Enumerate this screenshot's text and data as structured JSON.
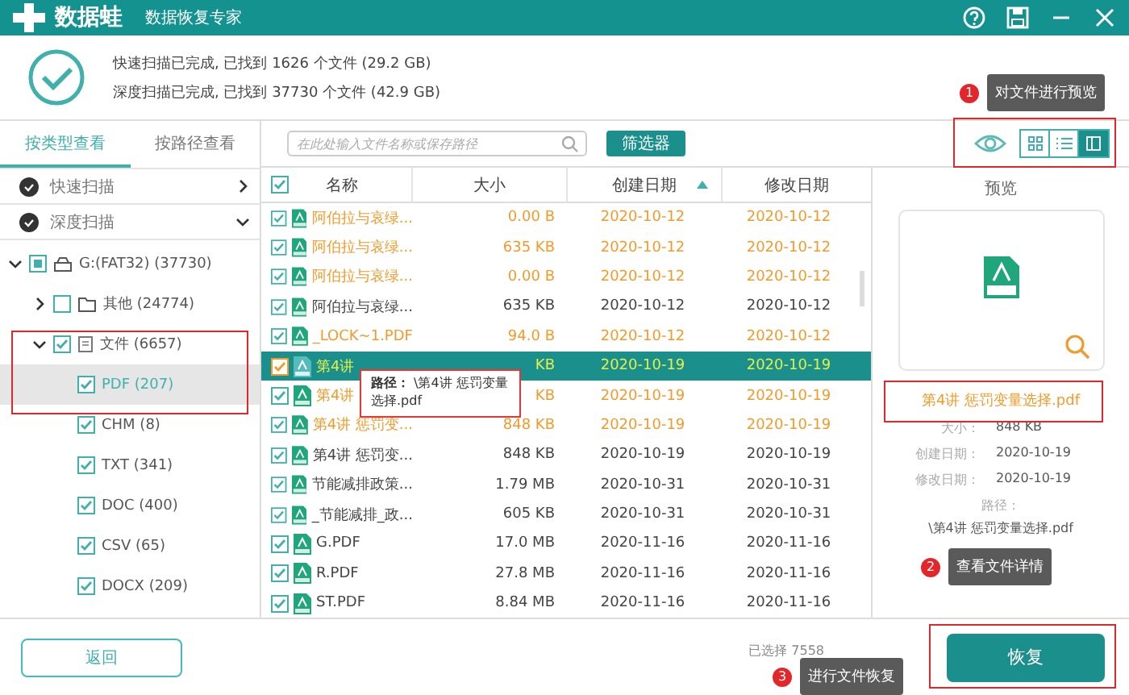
{
  "header": {
    "brand": "数据蛙",
    "subtitle": "数据恢复专家"
  },
  "scan_summary": [
    "快速扫描已完成, 已找到 1626 个文件 (29.2 GB)",
    "深度扫描已完成, 已找到 37730 个文件 (42.9 GB)"
  ],
  "view_tabs": [
    {
      "label": "按类型查看",
      "selected": true
    },
    {
      "label": "按路径查看",
      "selected": false
    }
  ],
  "scans": [
    {
      "label": "快速扫描",
      "expanded": false
    },
    {
      "label": "深度扫描",
      "expanded": true
    }
  ],
  "tree": [
    {
      "label": "G:(FAT32) (37730)",
      "kind": "drive",
      "checked": false,
      "partial": true,
      "expanded": true,
      "selected": false,
      "children": [
        {
          "label": "其他 (24774)",
          "kind": "folder",
          "checked": false,
          "partial": false,
          "expanded": false,
          "selected": false
        },
        {
          "label": "文件 (6657)",
          "kind": "document",
          "checked": true,
          "partial": false,
          "expanded": true,
          "selected": false,
          "children": [
            {
              "label": "PDF (207)",
              "checked": true,
              "selected": true
            },
            {
              "label": "CHM (8)",
              "checked": true,
              "selected": false
            },
            {
              "label": "TXT (341)",
              "checked": true,
              "selected": false
            },
            {
              "label": "DOC (400)",
              "checked": true,
              "selected": false
            },
            {
              "label": "CSV (65)",
              "checked": true,
              "selected": false
            },
            {
              "label": "DOCX (209)",
              "checked": true,
              "selected": false
            }
          ]
        }
      ]
    }
  ],
  "search": {
    "placeholder": "在此处输入文件名称或保存路径"
  },
  "filter_button": "筛选器",
  "table": {
    "all_checked": true,
    "columns": [
      {
        "label": "名称",
        "sorted": false
      },
      {
        "label": "大小",
        "sorted": false
      },
      {
        "label": "创建日期",
        "sorted": true
      },
      {
        "label": "修改日期",
        "sorted": false
      }
    ],
    "rows": [
      {
        "name": "阿伯拉与哀绿...",
        "size": "0.00  B",
        "created": "2020-10-12",
        "modified": "2020-10-12",
        "deleted": true,
        "selected": false,
        "checked": true
      },
      {
        "name": "阿伯拉与哀绿...",
        "size": "635 KB",
        "created": "2020-10-12",
        "modified": "2020-10-12",
        "deleted": true,
        "selected": false,
        "checked": true
      },
      {
        "name": "阿伯拉与哀绿...",
        "size": "0.00  B",
        "created": "2020-10-12",
        "modified": "2020-10-12",
        "deleted": true,
        "selected": false,
        "checked": true
      },
      {
        "name": "阿伯拉与哀绿...",
        "size": "635 KB",
        "created": "2020-10-12",
        "modified": "2020-10-12",
        "deleted": false,
        "selected": false,
        "checked": true
      },
      {
        "name": "_LOCK~1.PDF",
        "size": "94.0  B",
        "created": "2020-10-12",
        "modified": "2020-10-12",
        "deleted": true,
        "selected": false,
        "checked": true
      },
      {
        "name": "第4讲",
        "size": "KB",
        "created": "2020-10-19",
        "modified": "2020-10-19",
        "deleted": true,
        "selected": true,
        "checked": true
      },
      {
        "name": "第4讲",
        "size": "KB",
        "created": "2020-10-19",
        "modified": "2020-10-19",
        "deleted": true,
        "selected": false,
        "checked": true
      },
      {
        "name": "第4讲 惩罚变...",
        "size": "848 KB",
        "created": "2020-10-19",
        "modified": "2020-10-19",
        "deleted": true,
        "selected": false,
        "checked": true
      },
      {
        "name": "第4讲 惩罚变...",
        "size": "848 KB",
        "created": "2020-10-19",
        "modified": "2020-10-19",
        "deleted": false,
        "selected": false,
        "checked": true
      },
      {
        "name": "节能减排政策...",
        "size": "1.79 MB",
        "created": "2020-10-31",
        "modified": "2020-10-31",
        "deleted": false,
        "selected": false,
        "checked": true
      },
      {
        "name": "_节能减排_政...",
        "size": "605 KB",
        "created": "2020-10-31",
        "modified": "2020-10-31",
        "deleted": false,
        "selected": false,
        "checked": true
      },
      {
        "name": "G.PDF",
        "size": "17.0 MB",
        "created": "2020-11-16",
        "modified": "2020-11-16",
        "deleted": false,
        "selected": false,
        "checked": true
      },
      {
        "name": "R.PDF",
        "size": "27.8 MB",
        "created": "2020-11-16",
        "modified": "2020-11-16",
        "deleted": false,
        "selected": false,
        "checked": true
      },
      {
        "name": "ST.PDF",
        "size": "8.84 MB",
        "created": "2020-11-16",
        "modified": "2020-11-16",
        "deleted": false,
        "selected": false,
        "checked": true
      }
    ]
  },
  "path_tooltip": {
    "label": "路径：",
    "text": "\\第4讲 惩罚变量选择.pdf"
  },
  "view_modes": [
    {
      "kind": "grid",
      "selected": false
    },
    {
      "kind": "list",
      "selected": false
    },
    {
      "kind": "preview",
      "selected": true
    }
  ],
  "preview": {
    "title": "预览",
    "file_name": "第4讲 惩罚变量选择.pdf",
    "details": [
      {
        "label": "大小：",
        "value": "848 KB"
      },
      {
        "label": "创建日期：",
        "value": "2020-10-19"
      },
      {
        "label": "修改日期：",
        "value": "2020-10-19"
      }
    ],
    "path_label": "路径：",
    "path": "\\第4讲 惩罚变量选择.pdf"
  },
  "footer": {
    "back_button": "返回",
    "selection": "已选择 7558",
    "restore_button": "恢复"
  },
  "callouts": [
    {
      "number": "1",
      "text": "对文件进行预览"
    },
    {
      "number": "2",
      "text": "查看文件详情"
    },
    {
      "number": "3",
      "text": "进行文件恢复"
    }
  ]
}
